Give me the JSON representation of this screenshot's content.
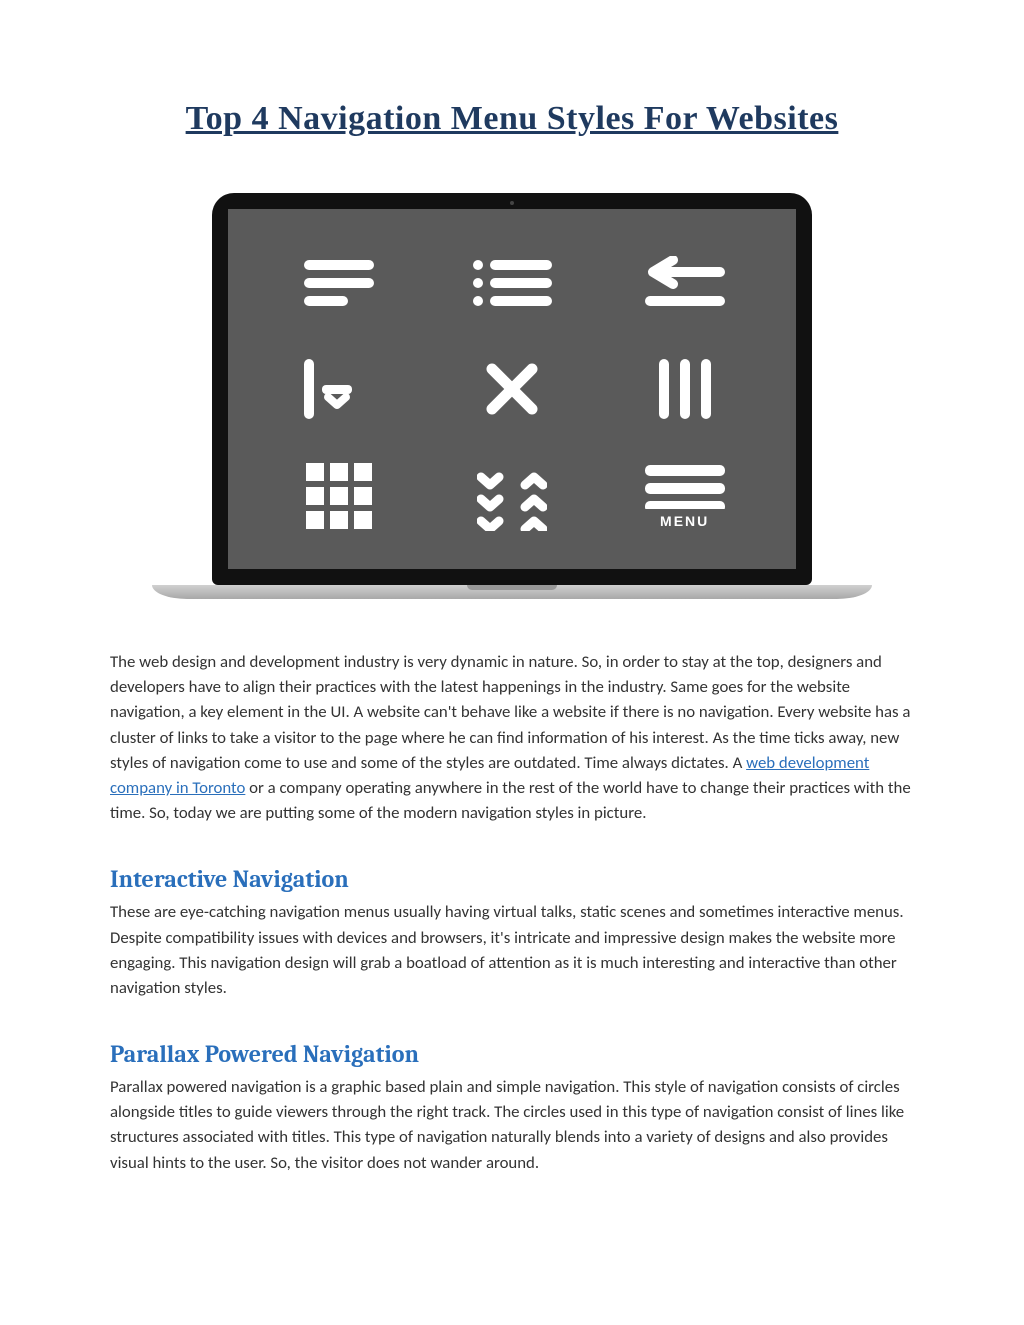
{
  "title": "Top 4 Navigation Menu Styles For Websites",
  "intro": {
    "part1": "The web design and development industry is very dynamic in nature. So, in order to stay at the top, designers and developers have to align their practices with the latest happenings in the industry. Same goes for the website navigation, a key element in the UI. A website can't behave like a website if there is no navigation. Every website has a cluster of links to take a visitor to the page where he can find information of his interest. As the time ticks away, new styles of navigation come to use and some of the styles are outdated. Time always dictates. A ",
    "link": "web development company in Toronto",
    "part2": " or a company operating anywhere in the rest of the world have to change their practices with the time. So, today we are putting some of the modern navigation styles in picture."
  },
  "sections": [
    {
      "heading": "Interactive Navigation",
      "body": "These are eye-catching navigation menus usually having virtual talks, static scenes and sometimes interactive menus. Despite compatibility issues with devices and browsers, it's intricate and impressive design makes the website more engaging. This navigation design will grab a boatload of attention as it is much interesting and interactive than other navigation styles."
    },
    {
      "heading": "Parallax Powered Navigation",
      "body": "Parallax powered navigation is a graphic based plain and simple navigation. This style of navigation consists of circles alongside titles to guide viewers through the right track. The circles used in this type of navigation consist of lines like structures associated with titles. This type of navigation naturally blends into a variety of designs and also provides visual hints to the user. So, the visitor does not wander around."
    }
  ],
  "icons": {
    "menu_label": "MENU"
  }
}
